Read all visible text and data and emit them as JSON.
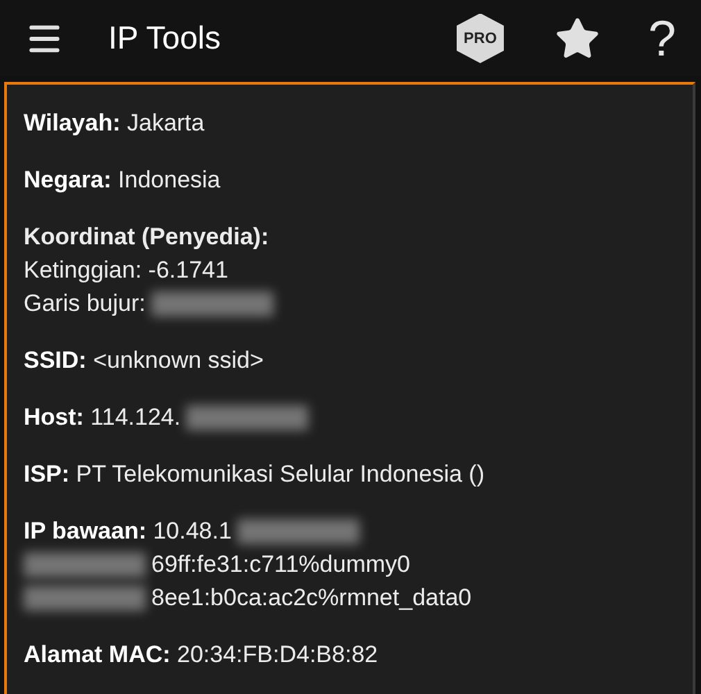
{
  "app_bar": {
    "title": "IP Tools",
    "pro_badge": "PRO",
    "help": "?"
  },
  "entries": [
    {
      "lines": [
        [
          {
            "kind": "text",
            "text": "**Wilayah:** Jakarta"
          }
        ]
      ]
    },
    {
      "lines": [
        [
          {
            "kind": "text",
            "text": "**Negara:** Indonesia"
          }
        ]
      ]
    },
    {
      "lines": [
        [
          {
            "kind": "heading",
            "text": "Koordinat (Penyedia):"
          }
        ],
        [
          {
            "kind": "text",
            "text": "Ketinggian: -6.1741"
          }
        ],
        [
          {
            "kind": "text",
            "text": "Garis bujur:"
          },
          {
            "kind": "redacted"
          }
        ]
      ]
    },
    {
      "lines": [
        [
          {
            "kind": "text",
            "text": "**SSID:** <unknown ssid>"
          }
        ]
      ]
    },
    {
      "lines": [
        [
          {
            "kind": "text",
            "text": "**Host:** 114.124."
          },
          {
            "kind": "redacted"
          }
        ]
      ]
    },
    {
      "lines": [
        [
          {
            "kind": "text",
            "text": "**ISP:** PT Telekomunikasi Selular Indonesia ()"
          }
        ]
      ]
    },
    {
      "lines": [
        [
          {
            "kind": "text",
            "text": "**IP bawaan:** 10.48.1"
          },
          {
            "kind": "redacted"
          }
        ],
        [
          {
            "kind": "redacted"
          },
          {
            "kind": "text",
            "text": "69ff:fe31:c711%dummy0"
          }
        ],
        [
          {
            "kind": "redacted"
          },
          {
            "kind": "text",
            "text": "8ee1:b0ca:ac2c%rmnet_data0"
          }
        ]
      ]
    },
    {
      "lines": [
        [
          {
            "kind": "text",
            "text": "**Alamat MAC:** 20:34:FB:D4:B8:82"
          }
        ]
      ]
    }
  ]
}
